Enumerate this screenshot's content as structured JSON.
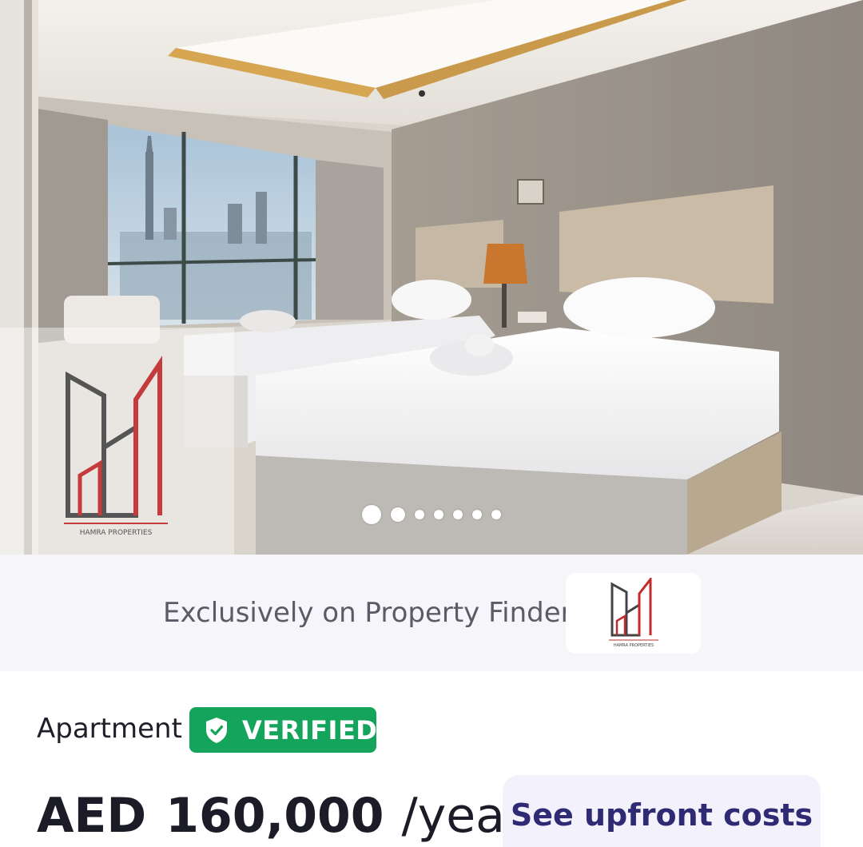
{
  "gallery": {
    "alt_label": "Bedroom photo",
    "total_photos": 7,
    "active_index": 1,
    "watermark_text": "HAMRA PROPERTIES"
  },
  "exclusive": {
    "text": "Exclusively on Property Finder",
    "agency_logo_text": "HAMRA PROPERTIES"
  },
  "listing": {
    "type": "Apartment",
    "badge": "VERIFIED",
    "price_currency": "AED",
    "price_amount": "160,000",
    "price_period": "/year",
    "upfront_button": "See upfront costs"
  },
  "colors": {
    "verified_green": "#14a45c",
    "upfront_text": "#2e2a73",
    "upfront_bg": "#f3f1fb",
    "banner_bg": "#f6f5fa"
  }
}
